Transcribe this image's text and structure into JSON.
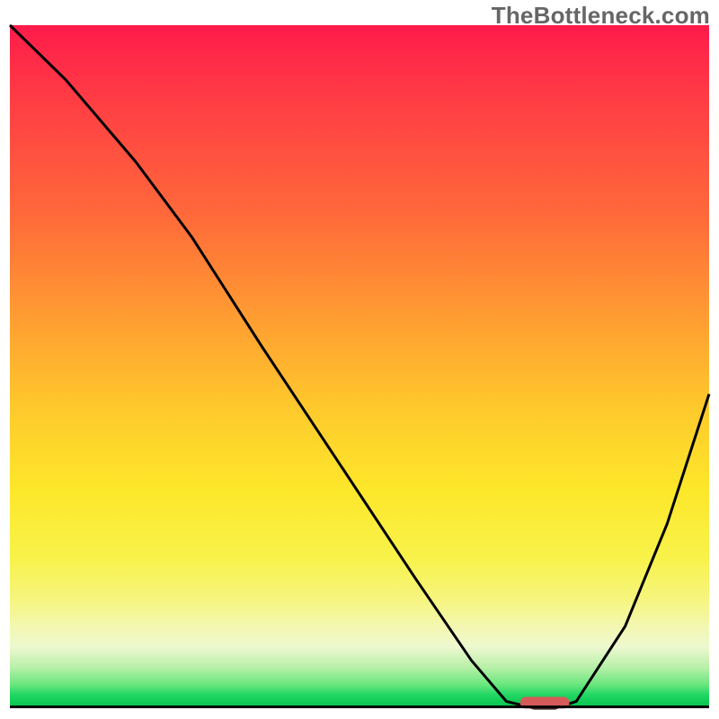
{
  "watermark": "TheBottleneck.com",
  "chart_data": {
    "type": "line",
    "title": "",
    "xlabel": "",
    "ylabel": "",
    "xlim": [
      0,
      100
    ],
    "ylim": [
      0,
      100
    ],
    "grid": false,
    "series": [
      {
        "name": "curve",
        "x": [
          0,
          8,
          18,
          26,
          36,
          47,
          58,
          66,
          71,
          75,
          78,
          81,
          88,
          94,
          100
        ],
        "values": [
          100,
          92,
          80,
          69,
          53,
          36,
          19,
          7,
          1,
          0,
          0,
          1,
          12,
          27,
          46
        ]
      }
    ],
    "marker": {
      "name": "optimal-range",
      "x_start": 73,
      "x_end": 80,
      "y": 0.8
    },
    "background": {
      "type": "vertical-gradient",
      "stops": [
        {
          "pos": 0,
          "color": "#ff1b4a"
        },
        {
          "pos": 0.28,
          "color": "#ff6a3a"
        },
        {
          "pos": 0.56,
          "color": "#ffc92c"
        },
        {
          "pos": 0.78,
          "color": "#f8f24a"
        },
        {
          "pos": 0.94,
          "color": "#b8f0a8"
        },
        {
          "pos": 1.0,
          "color": "#00c24a"
        }
      ]
    }
  }
}
